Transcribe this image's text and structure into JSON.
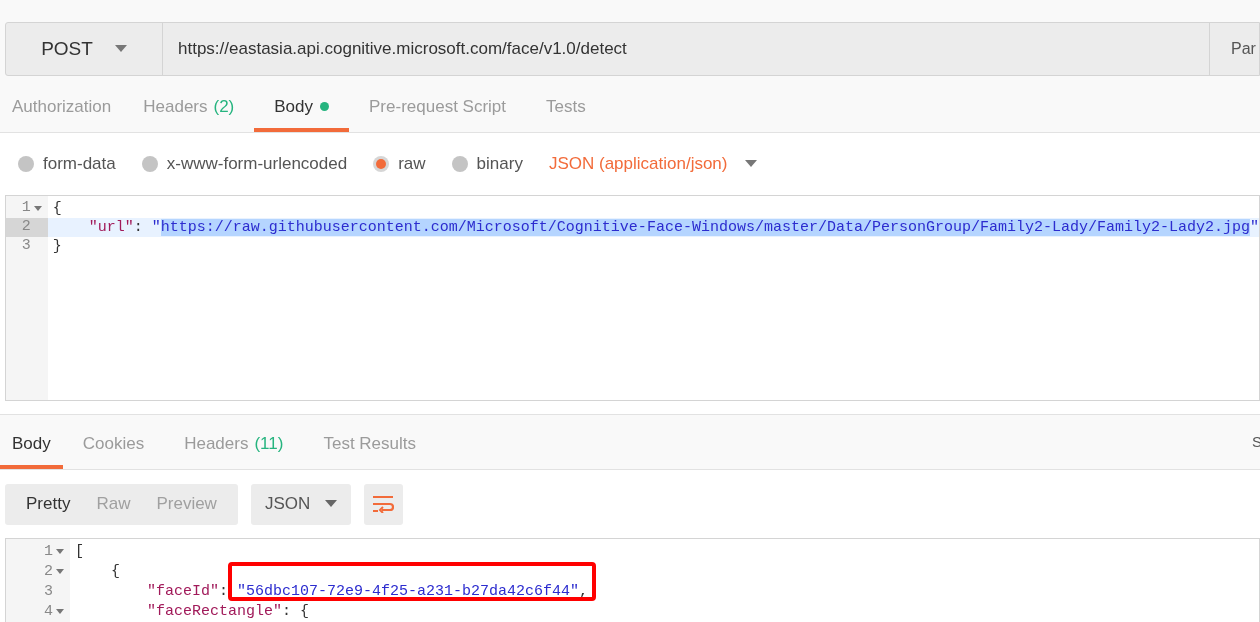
{
  "request": {
    "method": "POST",
    "url": "https://eastasia.api.cognitive.microsoft.com/face/v1.0/detect",
    "side_button": "Par"
  },
  "request_tabs": [
    {
      "label": "Authorization",
      "selected": false
    },
    {
      "label": "Headers",
      "count": "(2)",
      "selected": false
    },
    {
      "label": "Body",
      "dot": true,
      "selected": true
    },
    {
      "label": "Pre-request Script",
      "selected": false
    },
    {
      "label": "Tests",
      "selected": false
    }
  ],
  "body_types": [
    {
      "label": "form-data",
      "selected": false
    },
    {
      "label": "x-www-form-urlencoded",
      "selected": false
    },
    {
      "label": "raw",
      "selected": true
    },
    {
      "label": "binary",
      "selected": false
    }
  ],
  "content_type": "JSON (application/json)",
  "request_body": [
    {
      "number": "1",
      "fold": true,
      "active": false,
      "tokens": [
        {
          "kind": "punct",
          "text": "{"
        }
      ]
    },
    {
      "number": "2",
      "fold": false,
      "active": true,
      "tokens": [
        {
          "kind": "key",
          "text": "    \"url\""
        },
        {
          "kind": "punct",
          "text": ": "
        },
        {
          "kind": "string",
          "text": "\""
        },
        {
          "kind": "string",
          "text": "https://raw.githubusercontent.com/Microsoft/Cognitive-Face-Windows/master/Data/PersonGroup/Family2-Lady/Family2-Lady2.jpg",
          "selected": true
        },
        {
          "kind": "string",
          "text": "\""
        }
      ]
    },
    {
      "number": "3",
      "fold": false,
      "active": false,
      "tokens": [
        {
          "kind": "punct",
          "text": "}"
        }
      ]
    }
  ],
  "response_tabs": [
    {
      "label": "Body",
      "selected": true
    },
    {
      "label": "Cookies",
      "selected": false
    },
    {
      "label": "Headers",
      "count": "(11)",
      "selected": false
    },
    {
      "label": "Test Results",
      "selected": false
    }
  ],
  "response_side_text": "S",
  "view_modes": [
    {
      "label": "Pretty",
      "selected": true
    },
    {
      "label": "Raw",
      "selected": false
    },
    {
      "label": "Preview",
      "selected": false
    }
  ],
  "response_format": "JSON",
  "response_body": [
    {
      "number": "1",
      "fold": true,
      "tokens": [
        {
          "kind": "punct",
          "text": "["
        }
      ]
    },
    {
      "number": "2",
      "fold": true,
      "tokens": [
        {
          "kind": "punct",
          "text": "    {"
        }
      ]
    },
    {
      "number": "3",
      "fold": false,
      "tokens": [
        {
          "kind": "key",
          "text": "        \"faceId\""
        },
        {
          "kind": "punct",
          "text": ": "
        },
        {
          "kind": "string",
          "text": "\"56dbc107-72e9-4f25-a231-b27da42c6f44\""
        },
        {
          "kind": "punct",
          "text": ","
        }
      ]
    },
    {
      "number": "4",
      "fold": true,
      "tokens": [
        {
          "kind": "key",
          "text": "        \"faceRectangle\""
        },
        {
          "kind": "punct",
          "text": ": {"
        }
      ]
    }
  ]
}
